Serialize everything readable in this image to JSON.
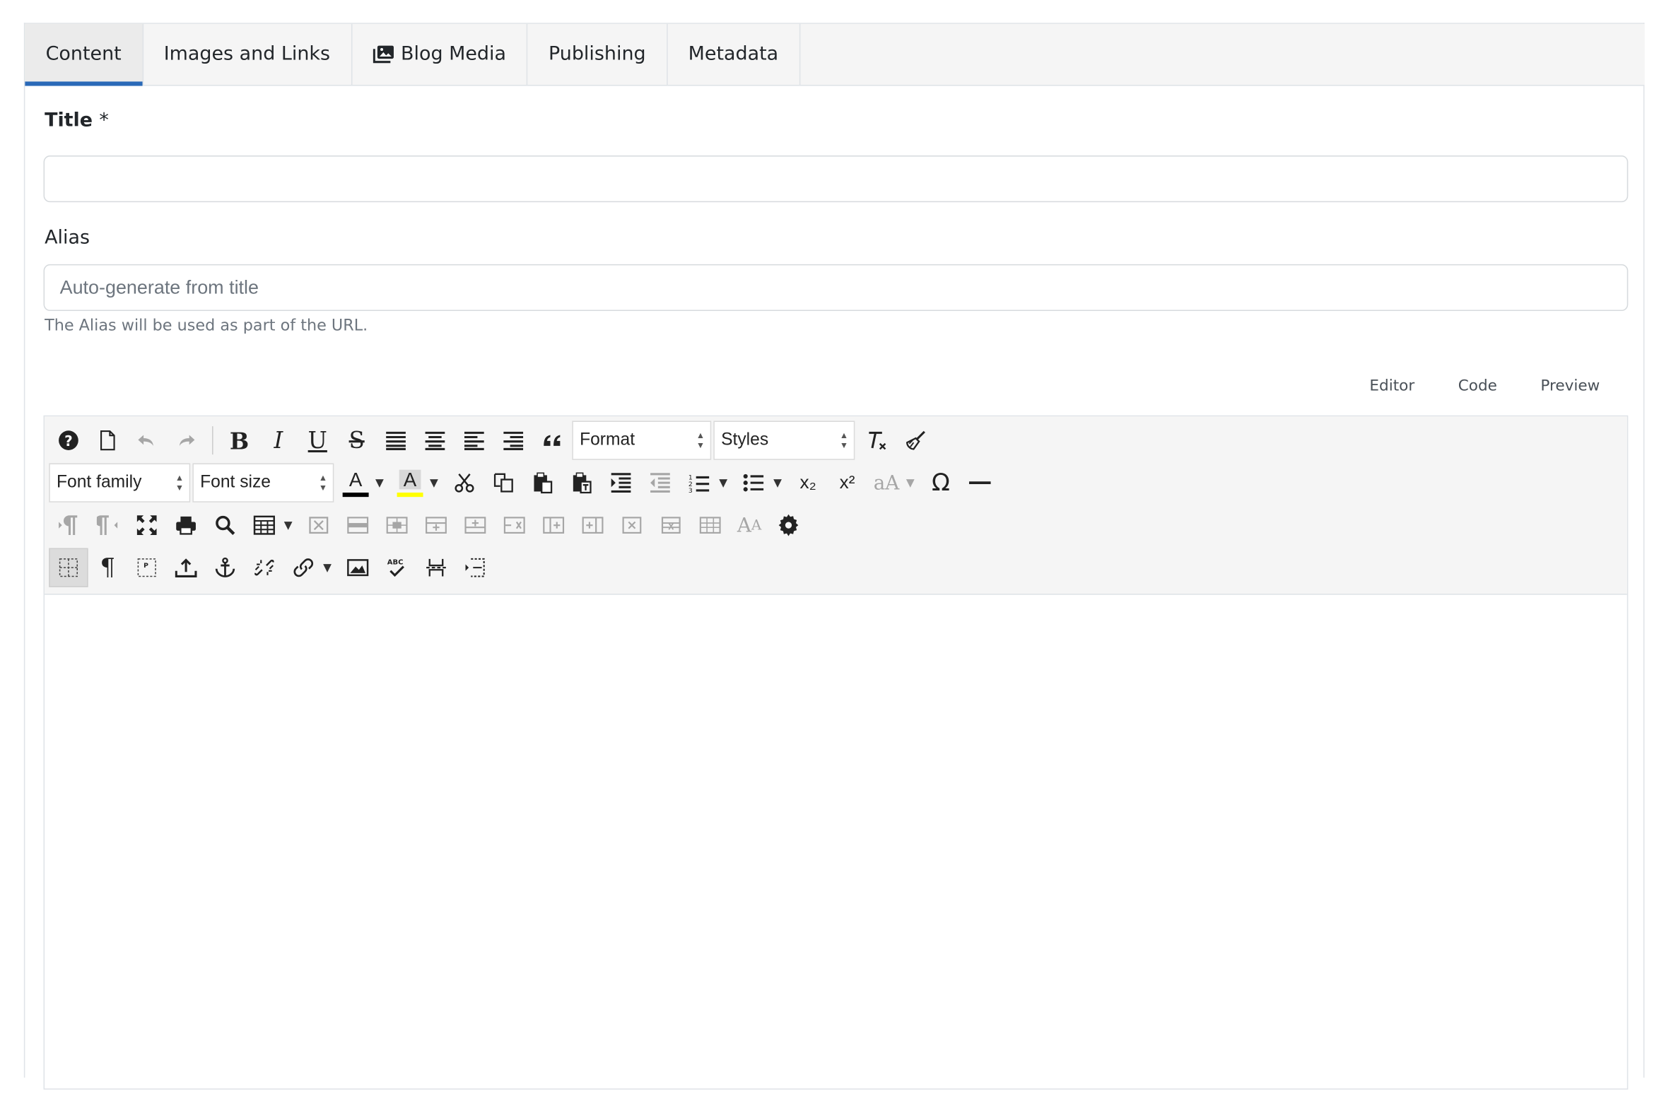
{
  "tabs": [
    {
      "label": "Content",
      "active": true
    },
    {
      "label": "Images and Links",
      "active": false
    },
    {
      "label": "Blog Media",
      "active": false,
      "icon": "images-icon"
    },
    {
      "label": "Publishing",
      "active": false
    },
    {
      "label": "Metadata",
      "active": false
    }
  ],
  "form": {
    "title_label": "Title",
    "title_required_mark": "*",
    "title_value": "",
    "alias_label": "Alias",
    "alias_value": "",
    "alias_placeholder": "Auto-generate from title",
    "alias_help": "The Alias will be used as part of the URL."
  },
  "editor_mode": {
    "editor": "Editor",
    "code": "Code",
    "preview": "Preview"
  },
  "toolbar": {
    "format_label": "Format",
    "styles_label": "Styles",
    "font_family_label": "Font family",
    "font_size_label": "Font size",
    "text_color_letter": "A",
    "highlight_letter": "A",
    "text_color": "#000000",
    "highlight_color": "#ffff00",
    "subscript": "x₂",
    "superscript": "x²",
    "omega": "Ω",
    "font_case": "aA",
    "spellcheck_abc": "ABC",
    "paragraph_p": "P"
  },
  "colors": {
    "accent": "#2a69b8",
    "tab_bg": "#f5f5f5",
    "border": "#dfe3e7",
    "muted_text": "#6d757e"
  },
  "editor_body": ""
}
